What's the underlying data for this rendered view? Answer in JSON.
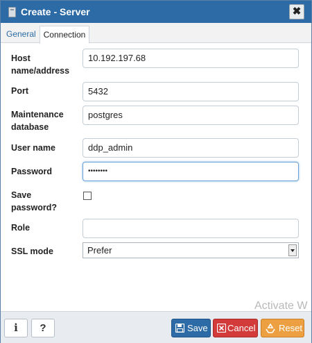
{
  "window": {
    "title": "Create - Server",
    "close_label": "✖"
  },
  "tabs": [
    {
      "label": "General",
      "active": false
    },
    {
      "label": "Connection",
      "active": true
    }
  ],
  "form": {
    "host_label": "Host name/address",
    "host_value": "10.192.197.68",
    "port_label": "Port",
    "port_value": "5432",
    "maintenance_db_label": "Maintenance database",
    "maintenance_db_value": "postgres",
    "username_label": "User name",
    "username_value": "ddp_admin",
    "password_label": "Password",
    "password_value": "••••••••",
    "save_password_label": "Save password?",
    "save_password_checked": false,
    "role_label": "Role",
    "role_value": "",
    "ssl_mode_label": "SSL mode",
    "ssl_mode_value": "Prefer"
  },
  "footer": {
    "info_label": "i",
    "help_label": "?",
    "save_label": "Save",
    "cancel_label": "Cancel",
    "reset_label": "Reset"
  },
  "watermark": "Activate W",
  "colors": {
    "titlebar": "#2c6ba6",
    "save": "#2c6ba6",
    "cancel": "#d33b3b",
    "reset": "#eda042"
  },
  "icons": {
    "title": "server-icon",
    "save": "floppy-disk-icon",
    "cancel": "x-icon",
    "reset": "recycle-icon"
  }
}
